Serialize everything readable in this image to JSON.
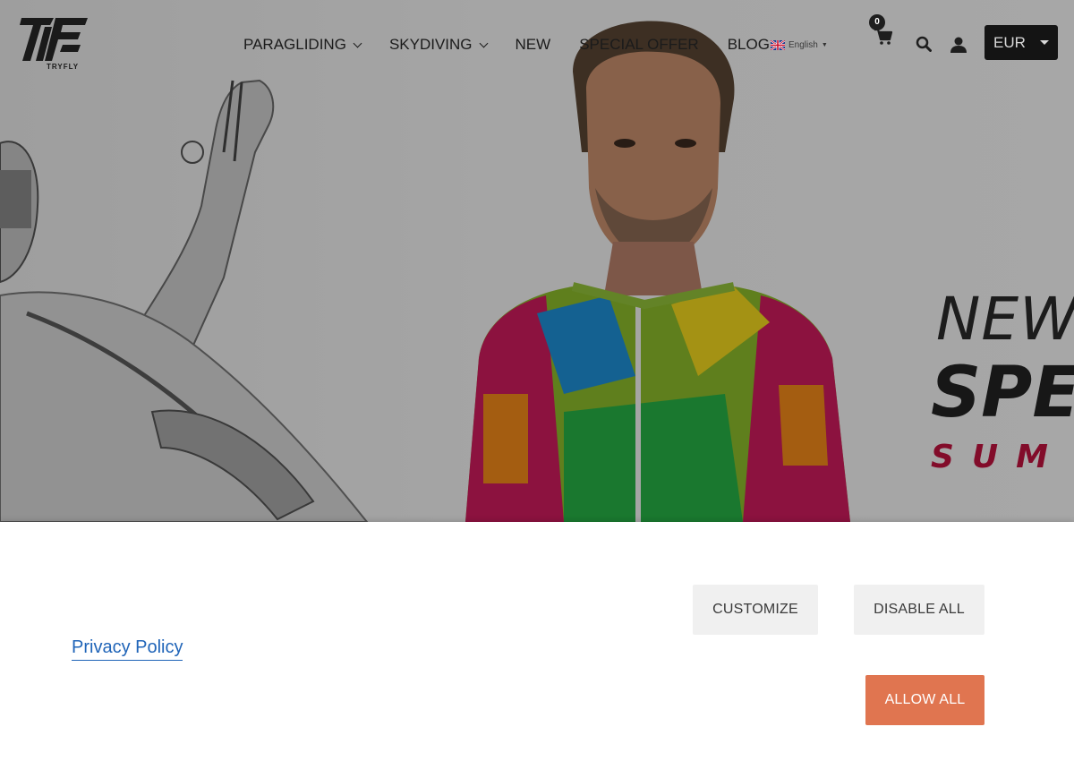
{
  "brand": {
    "logo_mark": "TF",
    "logo_text": "TRYFLY"
  },
  "nav": {
    "items": [
      {
        "label": "PARAGLIDING",
        "has_submenu": true
      },
      {
        "label": "SKYDIVING",
        "has_submenu": true
      },
      {
        "label": "NEW",
        "has_submenu": false
      },
      {
        "label": "SPECIAL OFFER",
        "has_submenu": false
      },
      {
        "label": "BLOG",
        "has_submenu": false
      }
    ]
  },
  "language": {
    "label": "English",
    "flag_icon": "uk-flag-icon"
  },
  "cart": {
    "count": "0",
    "icon": "cart-icon"
  },
  "header_icons": {
    "search": "search-icon",
    "account": "user-icon"
  },
  "currency": {
    "selected": "EUR"
  },
  "hero": {
    "line1": "NEW",
    "line2": "SPE",
    "line3": "SUM"
  },
  "cookie_bar": {
    "privacy_link": "Privacy Policy",
    "customize_label": "CUSTOMIZE",
    "disable_label": "DISABLE ALL",
    "allow_label": "ALLOW ALL"
  },
  "colors": {
    "allow_button": "#e07550",
    "link": "#1f64b8",
    "accent_red": "#c0123e"
  }
}
